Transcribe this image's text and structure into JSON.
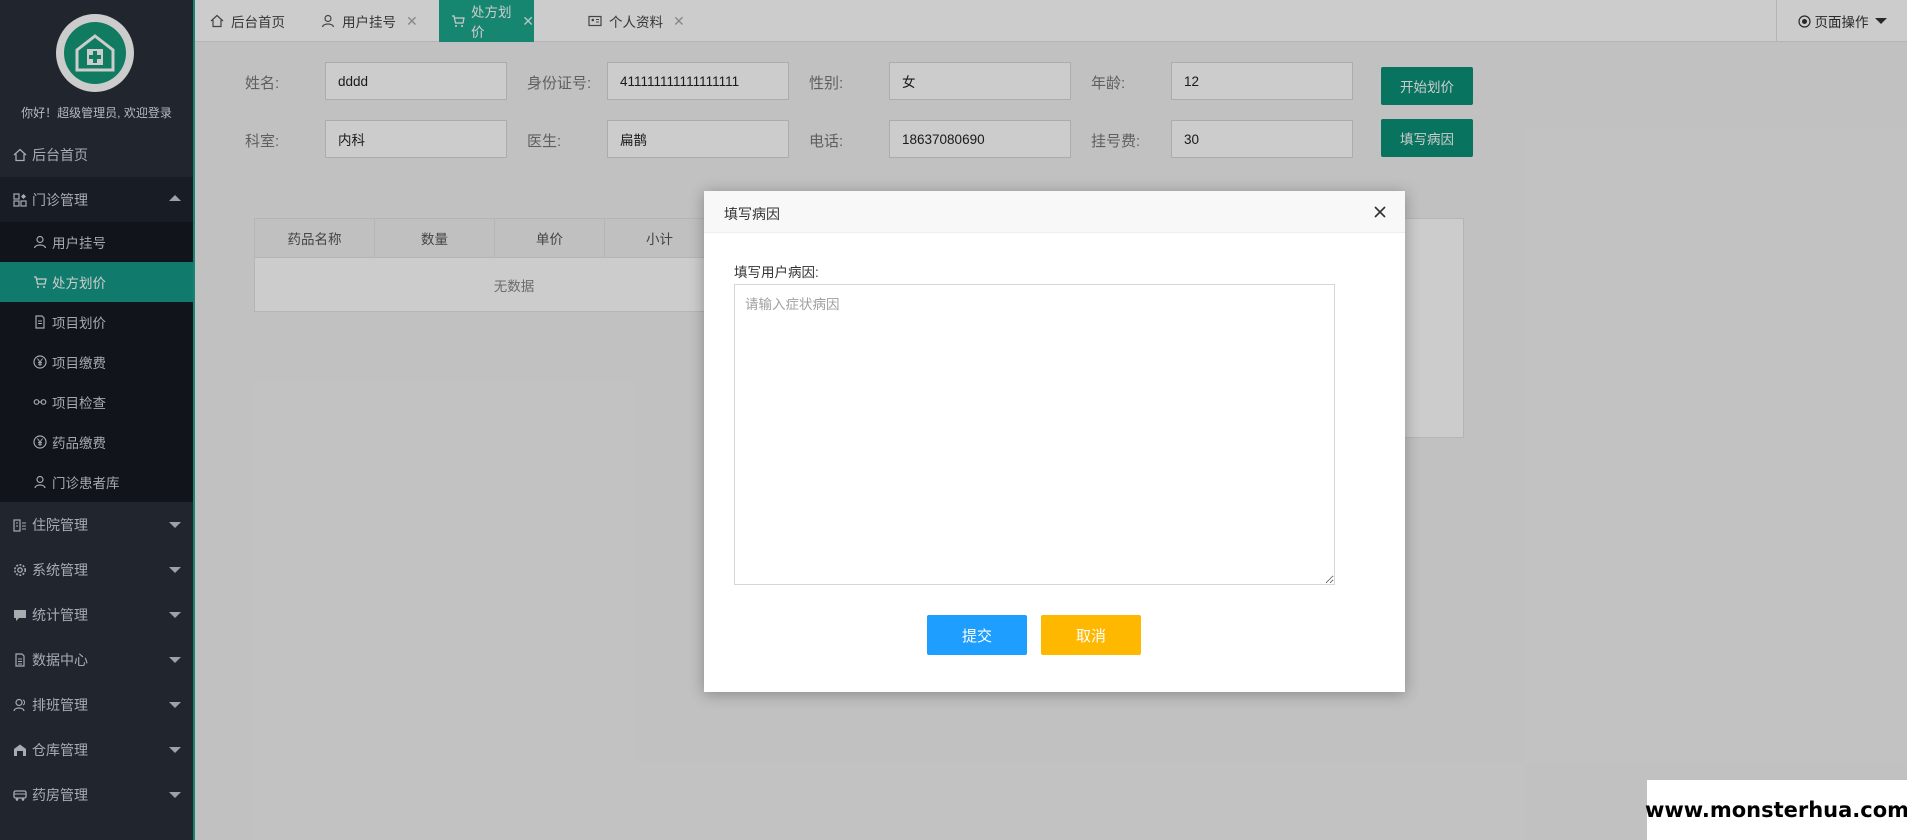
{
  "sidebar": {
    "greeting": "你好！超级管理员, 欢迎登录",
    "items": [
      {
        "label": "后台首页"
      },
      {
        "label": "门诊管理"
      },
      {
        "label": "住院管理"
      },
      {
        "label": "系统管理"
      },
      {
        "label": "统计管理"
      },
      {
        "label": "数据中心"
      },
      {
        "label": "排班管理"
      },
      {
        "label": "仓库管理"
      },
      {
        "label": "药房管理"
      }
    ],
    "subitems": [
      {
        "label": "用户挂号"
      },
      {
        "label": "处方划价"
      },
      {
        "label": "项目划价"
      },
      {
        "label": "项目缴费"
      },
      {
        "label": "项目检查"
      },
      {
        "label": "药品缴费"
      },
      {
        "label": "门诊患者库"
      }
    ]
  },
  "tabs": [
    {
      "label": "后台首页"
    },
    {
      "label": "用户挂号"
    },
    {
      "label": "处方划价"
    },
    {
      "label": "个人资料"
    }
  ],
  "page_ops": "页面操作",
  "form": {
    "name_label": "姓名:",
    "name_value": "dddd",
    "id_label": "身份证号:",
    "id_value": "411111111111111111",
    "gender_label": "性别:",
    "gender_value": "女",
    "age_label": "年龄:",
    "age_value": "12",
    "dept_label": "科室:",
    "dept_value": "内科",
    "doctor_label": "医生:",
    "doctor_value": "扁鹊",
    "phone_label": "电话:",
    "phone_value": "18637080690",
    "fee_label": "挂号费:",
    "fee_value": "30",
    "start_btn": "开始划价",
    "fill_btn": "填写病因"
  },
  "table": {
    "headers": [
      "药品名称",
      "数量",
      "单价",
      "小计"
    ],
    "empty": "无数据"
  },
  "modal": {
    "title": "填写病因",
    "label": "填写用户病因:",
    "placeholder": "请输入症状病因",
    "submit": "提交",
    "cancel": "取消"
  },
  "watermark": "www.monsterhua.com",
  "colors": {
    "sidebar_bg": "#2a2f3a",
    "accent": "#159a87",
    "submit": "#1e9fff",
    "cancel": "#ffb800"
  }
}
